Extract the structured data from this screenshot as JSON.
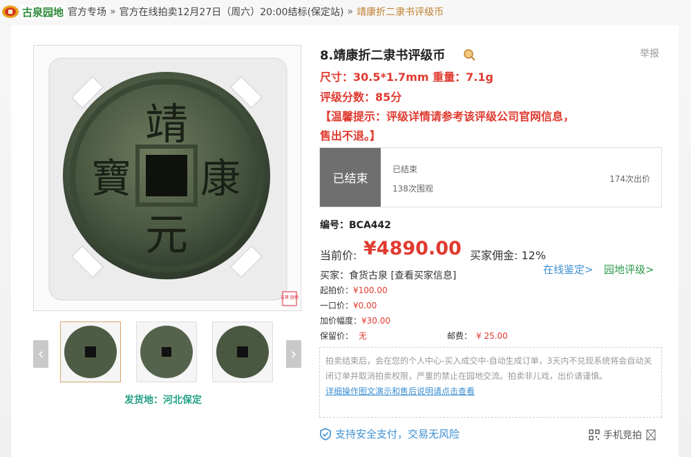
{
  "breadcrumb": {
    "logo_text": "古泉园地",
    "items": [
      "官方专场",
      "官方在线拍卖12月27日（周六）20:00结标(保定站)",
      "靖康折二隶书评级币"
    ]
  },
  "item": {
    "title": "8.靖康折二隶书评级币",
    "report": "举报",
    "size_line": "尺寸：30.5*1.7mm 重量：7.1g",
    "grade_line": "评级分数：85分",
    "tip_line": "【温馨提示：评级详情请参考该评级公司官网信息，售出不退。】",
    "stamp_text": "古泉\n园地",
    "coin_chars": [
      "靖",
      "康",
      "元",
      "寶"
    ]
  },
  "status": {
    "badge": "已结束",
    "sub": "已结束",
    "views": "138次围观",
    "bids": "174次出价"
  },
  "code_line": "编号：BCA442",
  "price": {
    "label": "当前价:",
    "value": "¥4890.00",
    "commission": "买家佣金: 12%"
  },
  "links": {
    "appraise": "在线鉴定>",
    "grade": "园地评级>"
  },
  "buyer_line": "买家：食货古泉 [查看买家信息]",
  "details": [
    {
      "k": "起拍价：",
      "v": "¥100.00"
    },
    {
      "k": "一口价：",
      "v": "¥0.00"
    },
    {
      "k": "加价幅度：",
      "v": "¥30.00"
    },
    {
      "k": "保留价：",
      "v": "无"
    }
  ],
  "shipping_fee": {
    "k": "邮费：",
    "v": "¥ 25.00"
  },
  "notice": {
    "text": "拍卖结束后，会在您的个人中心-买入成交中-自动生成订单，3天内不兑现系统将会自动关闭订单并取消拍卖权限，严重的禁止在园地交流。拍卖非儿戏，出价请谨慎。",
    "link": "详细操作图文演示和售后说明请点击查看"
  },
  "ship_from": "发货地：河北保定",
  "footer": {
    "secure": "支持安全支付，交易无风险",
    "phone_bid": "手机竞拍"
  },
  "colors": {
    "accent_red": "#e03a2f",
    "link_blue": "#3d8fd1",
    "green": "#2b9a4a",
    "teal": "#23a085"
  }
}
